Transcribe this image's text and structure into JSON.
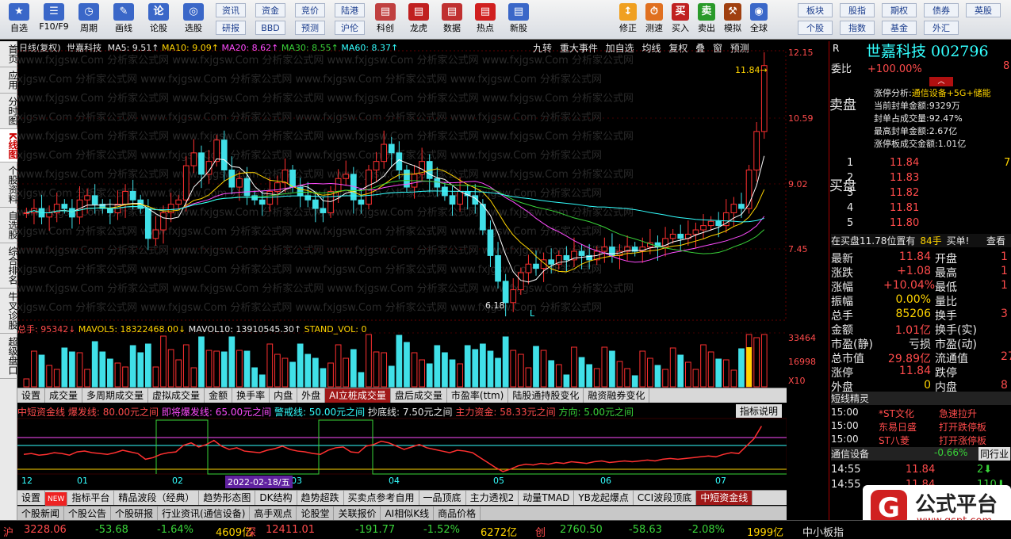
{
  "toolbar": {
    "buttons": [
      {
        "label": "自选",
        "icon": "star-icon",
        "color": "#3a67c8"
      },
      {
        "label": "F10/F9",
        "icon": "f10-icon",
        "color": "#3a67c8"
      },
      {
        "label": "周期",
        "icon": "clock-icon",
        "color": "#3a67c8"
      },
      {
        "label": "画线",
        "icon": "pencil-icon",
        "color": "#3a67c8"
      },
      {
        "label": "论股",
        "icon": "chat-icon",
        "color": "#3a67c8"
      },
      {
        "label": "选股",
        "icon": "target-icon",
        "color": "#3a67c8"
      }
    ],
    "tags_top": [
      "资讯",
      "资金",
      "竞价",
      "陆港"
    ],
    "tags_bottom": [
      "研报",
      "BBD",
      "预测",
      "沪伦"
    ],
    "buttons2": [
      {
        "label": "科创"
      },
      {
        "label": "龙虎"
      },
      {
        "label": "数据"
      },
      {
        "label": "热点"
      },
      {
        "label": "新股"
      }
    ],
    "buttons3": [
      {
        "label": "修正"
      },
      {
        "label": "测速"
      },
      {
        "label": "买入"
      },
      {
        "label": "卖出"
      },
      {
        "label": "模拟"
      },
      {
        "label": "全球"
      }
    ],
    "tags3_top": [
      "板块",
      "股指",
      "期权",
      "债券",
      "英股"
    ],
    "tags3_bottom": [
      "个股",
      "指数",
      "基金",
      "外汇"
    ]
  },
  "left_nav": [
    "首页",
    "应用",
    "分时图",
    "K线图",
    "个股资料",
    "自选股",
    "综合排名",
    "牛叉诊股",
    "超级盘口"
  ],
  "chart_header": {
    "period": "日线(复权)",
    "name": "世嘉科技",
    "ma5": "MA5: 9.51↑",
    "ma10": "MA10: 9.09↑",
    "ma20": "MA20: 8.62↑",
    "ma30": "MA30: 8.55↑",
    "ma60": "MA60: 8.37↑"
  },
  "chart_menu": [
    "九转",
    "重大事件",
    "加自选",
    "均线",
    "复权",
    "叠",
    "窗",
    "预测"
  ],
  "price_axis": [
    "12.15",
    "10.59",
    "9.02",
    "7.45"
  ],
  "annotations": {
    "high": "11.84→",
    "low": "6.18",
    "L": "L"
  },
  "watermark": "www.fxjgsw.Com 分析家公式网",
  "volume_header": {
    "total": "总手: 95342↓",
    "mavol5": "MAVOL5: 18322468.00↓",
    "mavol10": "MAVOL10: 13910545.30↑",
    "stand": "STAND_VOL: 0"
  },
  "volume_axis": [
    "33464",
    "16998",
    "X10"
  ],
  "sub_tabs": [
    "设置",
    "成交量",
    "多周期成交量",
    "虚拟成交量",
    "金额",
    "换手率",
    "内盘",
    "外盘",
    "AI立桩成交量",
    "盘后成交量",
    "市盈率(ttm)",
    "陆股通持股变化",
    "融资融券变化"
  ],
  "indicator_header": {
    "name": "中短资金线",
    "l1": "爆发线: 80.00元之间",
    "l2": "即将爆发线: 65.00元之间",
    "l3": "警戒线: 50.00元之间",
    "l4": "抄底线: 7.50元之间",
    "l5": "主力资金: 58.33元之间",
    "l6": "方向: 5.00元之间",
    "btn": "指标说明"
  },
  "date_axis": [
    "12",
    "01",
    "02",
    "03",
    "04",
    "05",
    "06",
    "07"
  ],
  "cursor_date": "2022-02-18/五",
  "bottom_tabs": [
    "设置",
    "NEW",
    "指标平台",
    "精品波段（经典）",
    "趋势形态图",
    "DK结构",
    "趋势超跌",
    "买卖点参考自用",
    "一品顶底",
    "主力透视2",
    "动量TMAD",
    "YB龙起爆点",
    "CCI波段顶底",
    "中短资金线"
  ],
  "news_tabs": [
    "个股新闻",
    "个股公告",
    "个股研报",
    "行业资讯(通信设备)",
    "高手观点",
    "论股堂",
    "关联报价",
    "AI相似K线",
    "商品价格"
  ],
  "quote": {
    "code_title": "世嘉科技 002796",
    "R": "R",
    "weibi_label": "委比",
    "weibi": "+100.00%",
    "weibi_end": "8",
    "zt_title": "涨停分析:",
    "zt_tag": "通信设备+5G+储能",
    "zt_lines": [
      "当前封单金额:9329万",
      "封单占成交量:92.47%",
      "最高封单金额:2.67亿",
      "涨停板成交金额:1.01亿"
    ],
    "sell_label": "卖盘",
    "buy_label": "买盘",
    "buy_book": [
      {
        "lvl": "1",
        "price": "11.84",
        "vol": "7"
      },
      {
        "lvl": "2",
        "price": "11.83",
        "vol": ""
      },
      {
        "lvl": "3",
        "price": "11.82",
        "vol": ""
      },
      {
        "lvl": "4",
        "price": "11.81",
        "vol": ""
      },
      {
        "lvl": "5",
        "price": "11.80",
        "vol": ""
      }
    ],
    "queue": "在买盘11.78位置有",
    "queue_vol": "84手",
    "queue_act": "买单!",
    "queue_btn": "查看",
    "stats": [
      {
        "l": "最新",
        "v": "11.84",
        "l2": "开盘",
        "v2": "1"
      },
      {
        "l": "涨跌",
        "v": "+1.08",
        "l2": "最高",
        "v2": "1"
      },
      {
        "l": "涨幅",
        "v": "+10.04%",
        "l2": "最低",
        "v2": "1"
      },
      {
        "l": "振幅",
        "v": "0.00%",
        "l2": "量比",
        "v2": ""
      },
      {
        "l": "总手",
        "v": "85206",
        "l2": "换手",
        "v2": "3"
      },
      {
        "l": "金额",
        "v": "1.01亿",
        "l2": "换手(实)",
        "v2": ""
      },
      {
        "l": "市盈(静)",
        "v": "亏损",
        "l2": "市盈(动)",
        "v2": ""
      },
      {
        "l": "总市值",
        "v": "29.89亿",
        "l2": "流通值",
        "v2": "27."
      },
      {
        "l": "涨停",
        "v": "11.84",
        "l2": "跌停",
        "v2": ""
      },
      {
        "l": "外盘",
        "v": "0",
        "l2": "内盘",
        "v2": "8"
      }
    ],
    "sprite_title": "短线精灵",
    "sprite": [
      {
        "t": "15:00",
        "s": "*ST文化",
        "e": "急速拉升"
      },
      {
        "t": "15:00",
        "s": "东易日盛",
        "e": "打开跌停板"
      },
      {
        "t": "15:00",
        "s": "ST八菱",
        "e": "打开涨停板"
      }
    ],
    "industry": "通信设备",
    "industry_pct": "-0.66%",
    "industry_btn": "同行业",
    "ticks": [
      {
        "t": "14:55",
        "p": "11.84",
        "v": "2"
      },
      {
        "t": "14:55",
        "p": "11.84",
        "v": "110"
      }
    ]
  },
  "status": {
    "sh": "沪",
    "sh_v": "3228.06",
    "sh_c": "-53.68",
    "sh_p": "-1.64%",
    "sh_a": "4609亿",
    "sz": "深",
    "sz_v": "12411.01",
    "sz_c": "-191.77",
    "sz_p": "-1.52%",
    "sz_a": "6272亿",
    "cy": "创",
    "cy_v": "2760.50",
    "cy_c": "-58.63",
    "cy_p": "-2.08%",
    "cy_a": "1999亿",
    "tail": "中小板指"
  },
  "logo": {
    "text": "公式平台",
    "url": "www.gspt.com",
    "glyph": "G"
  },
  "chart_data": {
    "type": "candlestick",
    "series": [
      {
        "name": "K",
        "values": [
          8.4,
          8.5,
          8.3,
          8.4,
          8.6,
          8.5,
          8.3,
          8.7,
          8.8,
          8.6,
          8.5,
          8.4,
          8.6,
          8.9,
          8.7,
          8.5,
          7.8,
          8.0,
          8.4,
          8.6,
          8.7,
          9.5,
          9.8,
          9.3,
          9.6,
          10.1,
          9.4,
          9.0,
          9.2,
          8.8,
          8.7,
          8.6,
          8.9,
          9.1,
          9.4,
          9.0,
          8.8,
          8.7,
          8.5,
          8.4,
          8.9,
          9.2,
          9.3,
          8.7,
          8.6,
          9.4,
          9.6,
          10.0,
          9.8,
          9.4,
          9.0,
          9.3,
          9.6,
          9.2,
          9.0,
          8.8,
          8.6,
          8.9,
          8.8,
          8.6,
          8.0,
          7.4,
          6.8,
          6.3,
          6.6,
          7.0,
          7.2,
          7.1,
          7.3,
          7.2,
          7.4,
          7.3,
          7.5,
          7.4,
          7.3,
          7.5,
          7.6,
          7.4,
          7.5,
          7.6,
          7.5,
          7.6,
          7.7,
          7.6,
          7.8,
          7.9,
          7.8,
          7.9,
          8.0,
          8.1,
          8.2,
          8.1,
          8.4,
          8.6,
          8.5,
          9.4,
          10.3,
          11.84
        ]
      }
    ],
    "ylim": [
      6.0,
      12.15
    ]
  }
}
